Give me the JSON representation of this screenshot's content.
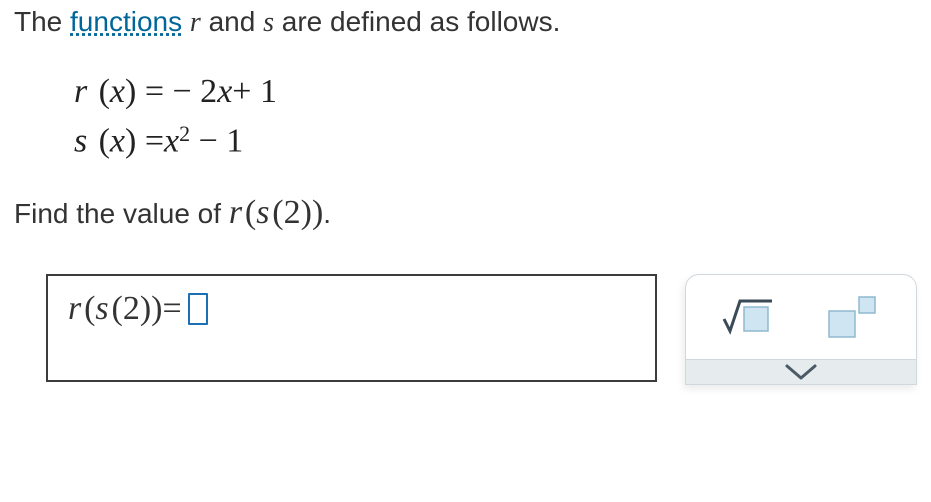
{
  "intro": {
    "prefix": "The ",
    "link_text": "functions",
    "mid1": " ",
    "var_r": "r",
    "mid2": " and ",
    "var_s": "s",
    "suffix": " are defined as follows."
  },
  "equations": {
    "r": {
      "name": "r",
      "arg": "x",
      "rhs_prefix": "= − 2",
      "rhs_var": "x",
      "rhs_suffix": "+ 1"
    },
    "s": {
      "name": "s",
      "arg": "x",
      "rhs_prefix": "=",
      "rhs_var": "x",
      "rhs_exp": "2",
      "rhs_suffix": " − 1"
    }
  },
  "prompt": {
    "prefix": "Find the value of ",
    "expr_r": "r",
    "expr_s": "s",
    "expr_inner": "2",
    "suffix": "."
  },
  "answer": {
    "expr_r": "r",
    "expr_s": "s",
    "expr_inner": "2",
    "equals": " = "
  },
  "palette": {
    "sqrt_label": "square-root",
    "power_label": "exponent"
  }
}
